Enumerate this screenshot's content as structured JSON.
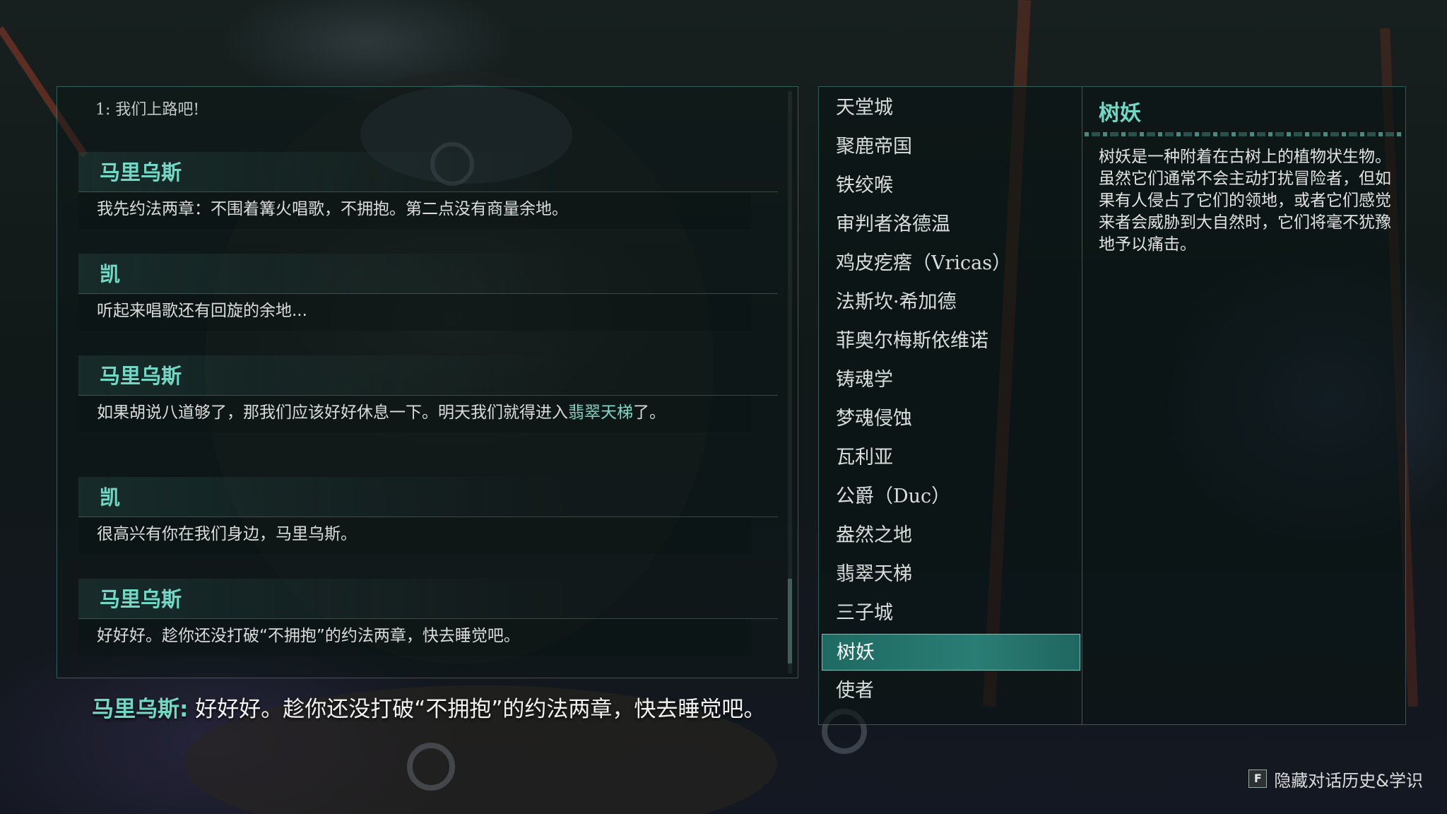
{
  "history": {
    "start_line": "1: 我们上路吧!",
    "entries": [
      {
        "speaker": "马里乌斯",
        "text": "我先约法两章：不围着篝火唱歌，不拥抱。第二点没有商量余地。"
      },
      {
        "speaker": "凯",
        "text": "听起来唱歌还有回旋的余地..."
      },
      {
        "speaker": "马里乌斯",
        "text_before": "如果胡说八道够了，那我们应该好好休息一下。明天我们就得进入",
        "text_highlight": "翡翠天梯",
        "text_after": "了。"
      },
      {
        "speaker": "凯",
        "text": "很高兴有你在我们身边，马里乌斯。"
      },
      {
        "speaker": "马里乌斯",
        "text": "好好好。趁你还没打破“不拥抱”的约法两章，快去睡觉吧。"
      }
    ]
  },
  "subtitle": {
    "speaker": "马里乌斯:",
    "text": "好好好。趁你还没打破“不拥抱”的约法两章，快去睡觉吧。"
  },
  "lore": {
    "items": [
      "天堂城",
      "聚鹿帝国",
      "铁绞喉",
      "审判者洛德温",
      "鸡皮疙瘩（Vricas）",
      "法斯坎·希加德",
      "菲奥尔梅斯依维诺",
      "铸魂学",
      "梦魂侵蚀",
      "瓦利亚",
      "公爵（Duc）",
      "盎然之地",
      "翡翠天梯",
      "三子城",
      "树妖",
      "使者"
    ],
    "selected_index": 14,
    "detail_title": "树妖",
    "detail_body": "树妖是一种附着在古树上的植物状生物。虽然它们通常不会主动打扰冒险者，但如果有人侵占了它们的领地，或者它们感觉来者会威胁到大自然时，它们将毫不犹豫地予以痛击。"
  },
  "hint": {
    "key": "F",
    "label": "隐藏对话历史&学识"
  },
  "colors": {
    "accent": "#6fd9c6",
    "panel_border": "#5ab4aa",
    "selected_bg": "#2a7d74"
  }
}
